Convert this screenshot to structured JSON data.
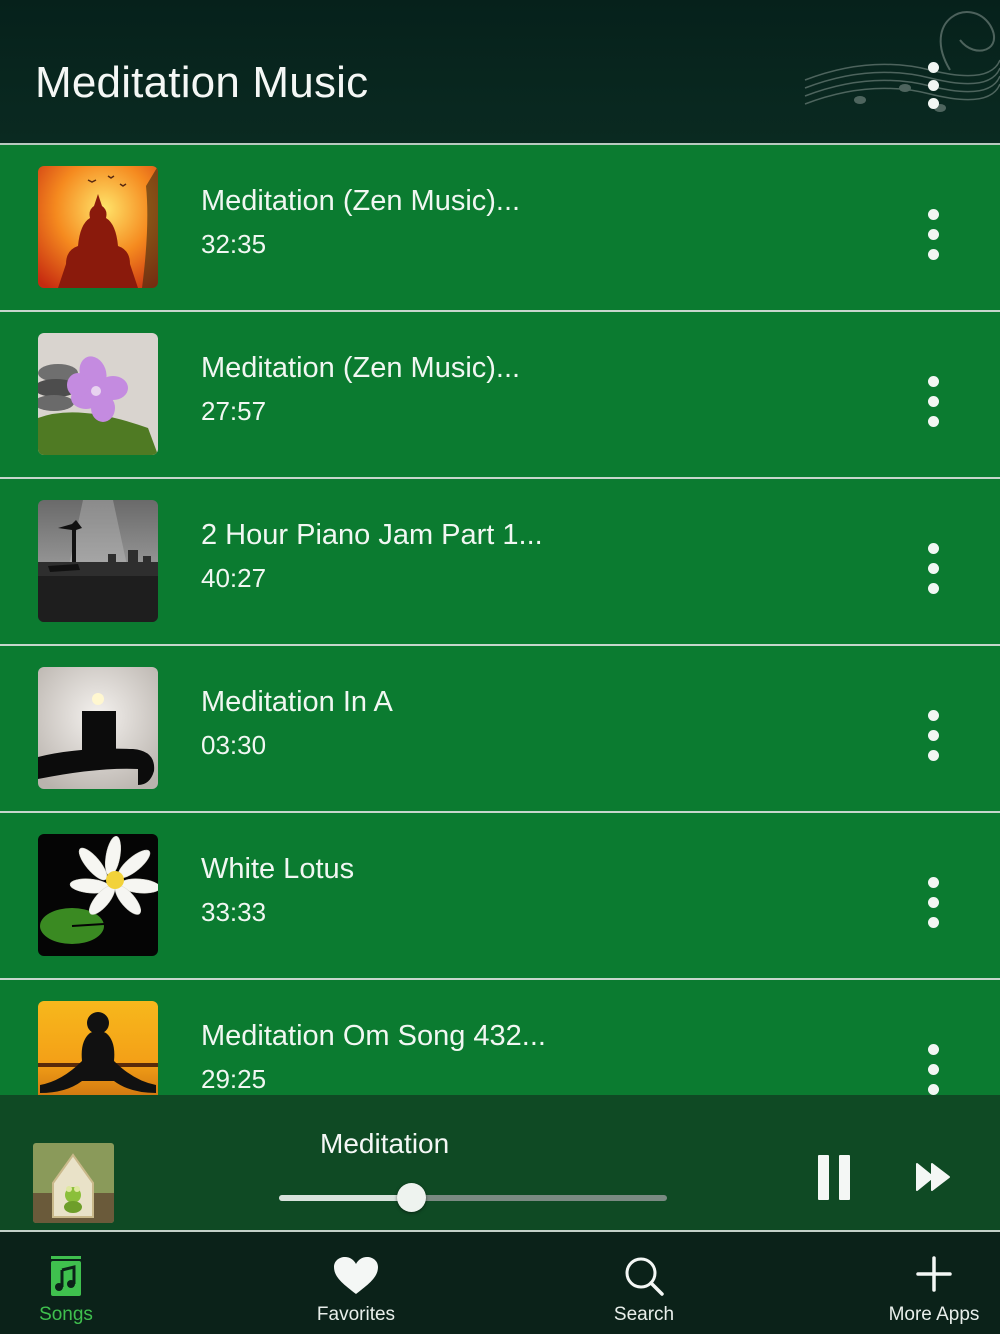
{
  "header": {
    "title": "Meditation Music",
    "menu_icon": "vertical-ellipsis-icon"
  },
  "songs": [
    {
      "title": "Meditation (Zen Music)...",
      "duration": "32:35",
      "art": "buddha-sunset-art"
    },
    {
      "title": "Meditation (Zen Music)...",
      "duration": "27:57",
      "art": "flower-stones-art"
    },
    {
      "title": "2 Hour Piano Jam Part 1...",
      "duration": "40:27",
      "art": "yoga-city-art"
    },
    {
      "title": "Meditation In A",
      "duration": "03:30",
      "art": "candle-hand-art"
    },
    {
      "title": "White Lotus",
      "duration": "33:33",
      "art": "white-lotus-art"
    },
    {
      "title": "Meditation Om Song 432...",
      "duration": "29:25",
      "art": "meditating-silhouette-art"
    }
  ],
  "now_playing": {
    "title": "Meditation",
    "progress": 0.34,
    "art": "frog-lantern-art",
    "pause_icon": "pause-icon",
    "next_icon": "fast-forward-icon"
  },
  "tabs": [
    {
      "label": "Songs",
      "icon": "music-note-icon",
      "active": true
    },
    {
      "label": "Favorites",
      "icon": "heart-icon",
      "active": false
    },
    {
      "label": "Search",
      "icon": "search-icon",
      "active": false
    },
    {
      "label": "More Apps",
      "icon": "plus-icon",
      "active": false
    }
  ],
  "colors": {
    "header_bg": "#06211b",
    "list_bg": "#0b7b30",
    "player_bg": "#0f4a24",
    "tabbar_bg": "#0b2219",
    "active_tab": "#3fc04e"
  }
}
